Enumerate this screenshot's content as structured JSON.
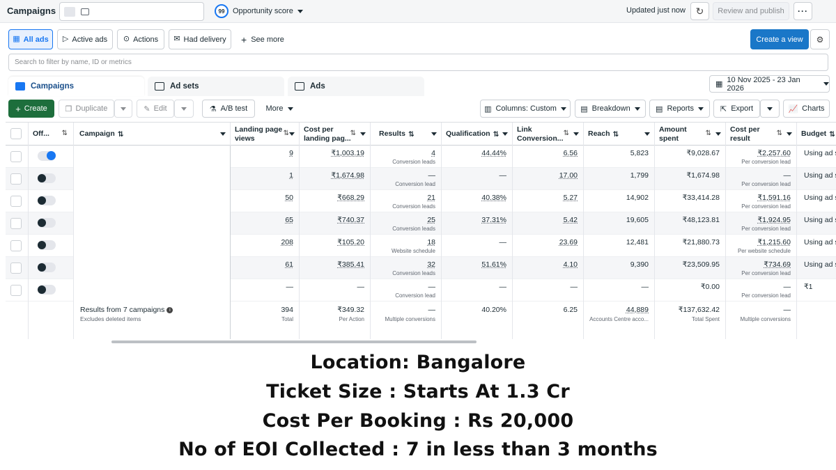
{
  "topbar": {
    "title": "Campaigns",
    "opportunity_score": "99",
    "opportunity_label": "Opportunity score",
    "updated": "Updated just now",
    "review_publish": "Review and publish"
  },
  "filters": {
    "all_ads": "All ads",
    "active_ads": "Active ads",
    "actions": "Actions",
    "had_delivery": "Had delivery",
    "see_more": "See more",
    "create_view": "Create a view",
    "search_placeholder": "Search to filter by name, ID or metrics"
  },
  "tabs": {
    "campaigns": "Campaigns",
    "ad_sets": "Ad sets",
    "ads": "Ads",
    "date_range": "10 Nov 2025 - 23 Jan 2026"
  },
  "toolbar": {
    "create": "Create",
    "duplicate": "Duplicate",
    "edit": "Edit",
    "ab_test": "A/B test",
    "more": "More",
    "columns": "Columns: Custom",
    "breakdown": "Breakdown",
    "reports": "Reports",
    "export": "Export",
    "charts": "Charts"
  },
  "table": {
    "headers": {
      "off": "Off...",
      "campaign": "Campaign",
      "lpv": [
        "Landing page",
        "views"
      ],
      "cplpv": [
        "Cost per",
        "landing pag..."
      ],
      "results": "Results",
      "qualification": "Qualification",
      "link_conv": [
        "Link",
        "Conversion..."
      ],
      "reach": "Reach",
      "amount": [
        "Amount",
        "spent"
      ],
      "cpr": [
        "Cost per",
        "result"
      ],
      "budget": "Budget"
    },
    "rows": [
      {
        "on": true,
        "lpv": "9",
        "cplpv": "₹1,003.19",
        "results": "4",
        "results_sub": "Conversion leads",
        "qual": "44.44%",
        "link": "6.56",
        "reach": "5,823",
        "amount": "₹9,028.67",
        "cpr": "₹2,257.60",
        "cpr_sub": "Per conversion lead",
        "budget": "Using ad s"
      },
      {
        "on": false,
        "lpv": "1",
        "cplpv": "₹1,674.98",
        "results": "—",
        "results_sub": "Conversion lead",
        "qual": "—",
        "link": "17.00",
        "reach": "1,799",
        "amount": "₹1,674.98",
        "cpr": "—",
        "cpr_sub": "Per conversion lead",
        "budget": "Using ad s"
      },
      {
        "on": false,
        "lpv": "50",
        "cplpv": "₹668.29",
        "results": "21",
        "results_sub": "Conversion leads",
        "qual": "40.38%",
        "link": "5.27",
        "reach": "14,902",
        "amount": "₹33,414.28",
        "cpr": "₹1,591.16",
        "cpr_sub": "Per conversion lead",
        "budget": "Using ad s"
      },
      {
        "on": false,
        "lpv": "65",
        "cplpv": "₹740.37",
        "results": "25",
        "results_sub": "Conversion leads",
        "qual": "37.31%",
        "link": "5.42",
        "reach": "19,605",
        "amount": "₹48,123.81",
        "cpr": "₹1,924.95",
        "cpr_sub": "Per conversion lead",
        "budget": "Using ad s"
      },
      {
        "on": false,
        "lpv": "208",
        "cplpv": "₹105.20",
        "results": "18",
        "results_sub": "Website schedule",
        "qual": "—",
        "link": "23.69",
        "reach": "12,481",
        "amount": "₹21,880.73",
        "cpr": "₹1,215.60",
        "cpr_sub": "Per website schedule",
        "budget": "Using ad s"
      },
      {
        "on": false,
        "lpv": "61",
        "cplpv": "₹385.41",
        "results": "32",
        "results_sub": "Conversion leads",
        "qual": "51.61%",
        "link": "4.10",
        "reach": "9,390",
        "amount": "₹23,509.95",
        "cpr": "₹734.69",
        "cpr_sub": "Per conversion lead",
        "budget": "Using ad s"
      },
      {
        "on": false,
        "lpv": "—",
        "cplpv": "—",
        "results": "—",
        "results_sub": "Conversion lead",
        "qual": "—",
        "link": "—",
        "reach": "—",
        "amount": "₹0.00",
        "cpr": "—",
        "cpr_sub": "Per conversion lead",
        "budget": "₹1"
      }
    ],
    "totals": {
      "label": "Results from 7 campaigns",
      "sub": "Excludes deleted items",
      "lpv": "394",
      "lpv_sub": "Total",
      "cplpv": "₹349.32",
      "cplpv_sub": "Per Action",
      "results": "—",
      "results_sub": "Multiple conversions",
      "qual": "40.20%",
      "link": "6.25",
      "reach": "44,889",
      "reach_sub": "Accounts Centre acco...",
      "amount": "₹137,632.42",
      "amount_sub": "Total Spent",
      "cpr": "—",
      "cpr_sub": "Multiple conversions"
    }
  },
  "overlay": {
    "line1": "Location: Bangalore",
    "line2": "Ticket Size : Starts At 1.3 Cr",
    "line3": "Cost Per Booking : Rs 20,000",
    "line4": "No of EOI Collected : 7 in less than 3 months"
  },
  "colors": {
    "accent": "#1877f2",
    "create_green": "#1d6e3c",
    "create_view_blue": "#1a77c8"
  }
}
